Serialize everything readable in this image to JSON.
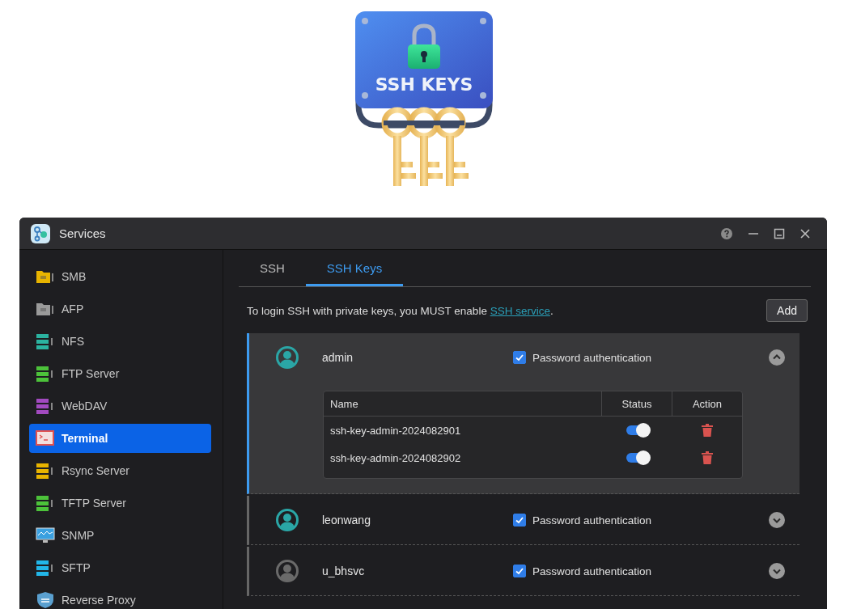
{
  "banner": {
    "title": "SSH KEYS"
  },
  "window": {
    "title": "Services"
  },
  "sidebar": {
    "items": [
      {
        "label": "SMB",
        "kind": "folder",
        "color": "#e8b400",
        "selected": false
      },
      {
        "label": "AFP",
        "kind": "folder",
        "color": "#9a9a9a",
        "selected": false
      },
      {
        "label": "NFS",
        "kind": "stack",
        "color": "#2bb3a0",
        "selected": false
      },
      {
        "label": "FTP Server",
        "kind": "stack",
        "color": "#4cc23a",
        "selected": false
      },
      {
        "label": "WebDAV",
        "kind": "stack",
        "color": "#a24ac0",
        "selected": false
      },
      {
        "label": "Terminal",
        "kind": "terminal",
        "color": "#e05050",
        "selected": true
      },
      {
        "label": "Rsync Server",
        "kind": "stack",
        "color": "#e8b400",
        "selected": false
      },
      {
        "label": "TFTP Server",
        "kind": "stack",
        "color": "#4cc23a",
        "selected": false
      },
      {
        "label": "SNMP",
        "kind": "monitor",
        "color": "#3aa0e0",
        "selected": false
      },
      {
        "label": "SFTP",
        "kind": "stack",
        "color": "#22b6e8",
        "selected": false
      },
      {
        "label": "Reverse Proxy",
        "kind": "shield",
        "color": "#5aa0d0",
        "selected": false
      }
    ]
  },
  "tabs": [
    {
      "label": "SSH",
      "selected": false
    },
    {
      "label": "SSH Keys",
      "selected": true
    }
  ],
  "notice": {
    "text": "To login SSH with private keys, you MUST enable ",
    "link": "SSH service",
    "end": "."
  },
  "add_button": "Add",
  "accounts": [
    {
      "name": "admin",
      "color": "#2aa6a6",
      "selected": true,
      "expanded": true,
      "password_auth": {
        "label": "Password authentication",
        "checked": true
      },
      "keys": {
        "columns": [
          "Name",
          "Status",
          "Action"
        ],
        "rows": [
          {
            "name": "ssh-key-admin-2024082901",
            "on": true
          },
          {
            "name": "ssh-key-admin-2024082902",
            "on": true
          }
        ]
      }
    },
    {
      "name": "leonwang",
      "color": "#2aa6a6",
      "selected": false,
      "expanded": false,
      "password_auth": {
        "label": "Password authentication",
        "checked": true
      }
    },
    {
      "name": "u_bhsvc",
      "color": "#6a6a6a",
      "selected": false,
      "expanded": false,
      "password_auth": {
        "label": "Password authentication",
        "checked": true
      }
    }
  ]
}
